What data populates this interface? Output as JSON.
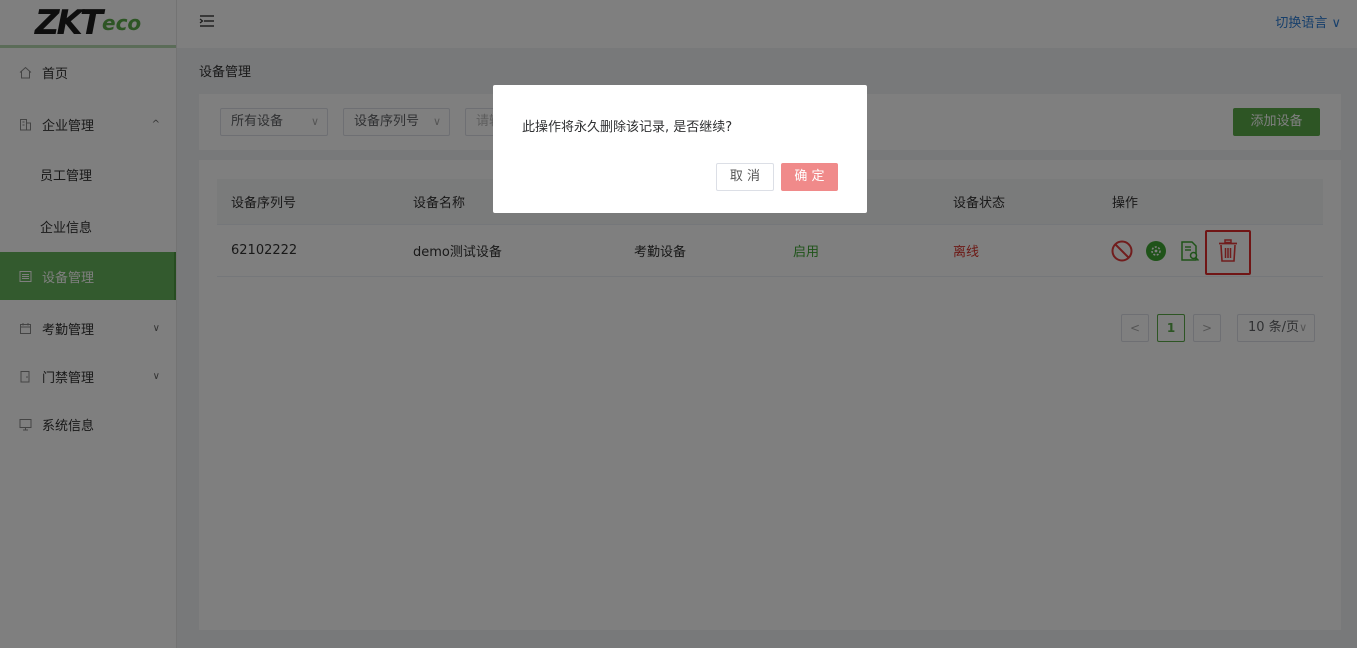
{
  "brand": {
    "logo_main": "ZKT",
    "logo_sub": "eco"
  },
  "header": {
    "language_switch": "切换语言 ∨"
  },
  "sidebar": {
    "items": [
      {
        "label": "首页",
        "icon": "home-icon"
      },
      {
        "label": "企业管理",
        "icon": "building-icon",
        "arrow": "^"
      },
      {
        "label": "员工管理"
      },
      {
        "label": "企业信息"
      },
      {
        "label": "设备管理",
        "icon": "device-list-icon"
      },
      {
        "label": "考勤管理",
        "icon": "calendar-icon",
        "arrow": "∨"
      },
      {
        "label": "门禁管理",
        "icon": "door-icon",
        "arrow": "∨"
      },
      {
        "label": "系统信息",
        "icon": "monitor-icon"
      }
    ]
  },
  "breadcrumb": "设备管理",
  "filters": {
    "device_type": "所有设备",
    "field": "设备序列号",
    "search_placeholder": "请输入",
    "add_button": "添加设备"
  },
  "table": {
    "columns": [
      "设备序列号",
      "设备名称",
      "",
      "",
      "设备状态",
      "操作"
    ],
    "rows": [
      {
        "serial": "62102222",
        "name": "demo测试设备",
        "type": "考勤设备",
        "enabled": "启用",
        "status": "离线"
      }
    ]
  },
  "pagination": {
    "prev": "<",
    "current": "1",
    "next": ">",
    "page_size": "10 条/页"
  },
  "dialog": {
    "message": "此操作将永久删除该记录, 是否继续?",
    "cancel": "取 消",
    "confirm": "确 定"
  },
  "colors": {
    "accent": "#5aaa49",
    "danger": "#e02a2a",
    "link": "#2f7fd6"
  }
}
